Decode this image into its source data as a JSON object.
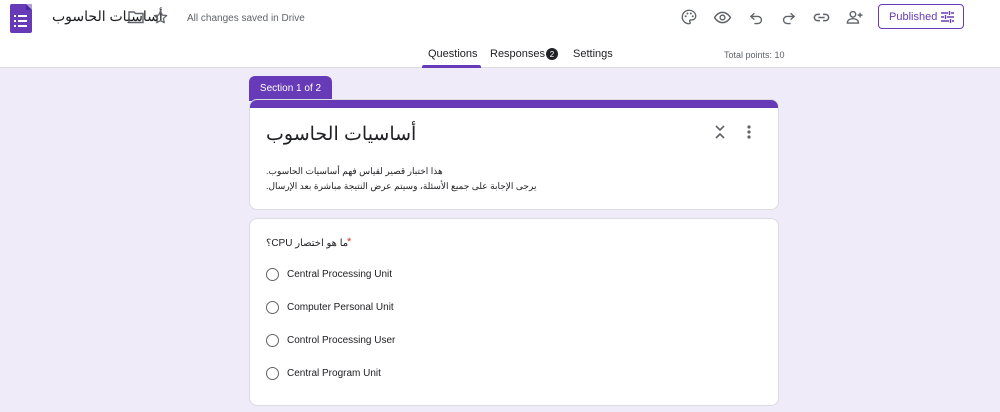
{
  "header": {
    "doc_title": "أساسيات الحاسوب",
    "save_status": "All changes saved in Drive",
    "published_label": "Published",
    "brand_color": "#673ab7",
    "icons": [
      "forms-app-icon",
      "folder-icon",
      "star-icon",
      "palette-icon",
      "preview-icon",
      "undo-icon",
      "redo-icon",
      "link-icon",
      "add-collaborator-icon",
      "tune-icon"
    ]
  },
  "tabs": {
    "questions": "Questions",
    "responses": "Responses",
    "responses_count": "2",
    "settings": "Settings",
    "active": "Questions",
    "total_points": "Total points: 10"
  },
  "section": {
    "label": "Section 1 of 2"
  },
  "form": {
    "title": "أساسيات الحاسوب",
    "description_line1": "هذا اختبار قصير لقياس فهم أساسيات الحاسوب.",
    "description_line2": "يرجى الإجابة على جميع الأسئلة، وسيتم عرض النتيجة مباشرة بعد الإرسال."
  },
  "question": {
    "title": "ما هو اختصار CPU؟",
    "required_mark": "*",
    "options": [
      "Central Processing Unit",
      "Computer Personal Unit",
      "Control Processing User",
      "Central Program Unit"
    ]
  }
}
